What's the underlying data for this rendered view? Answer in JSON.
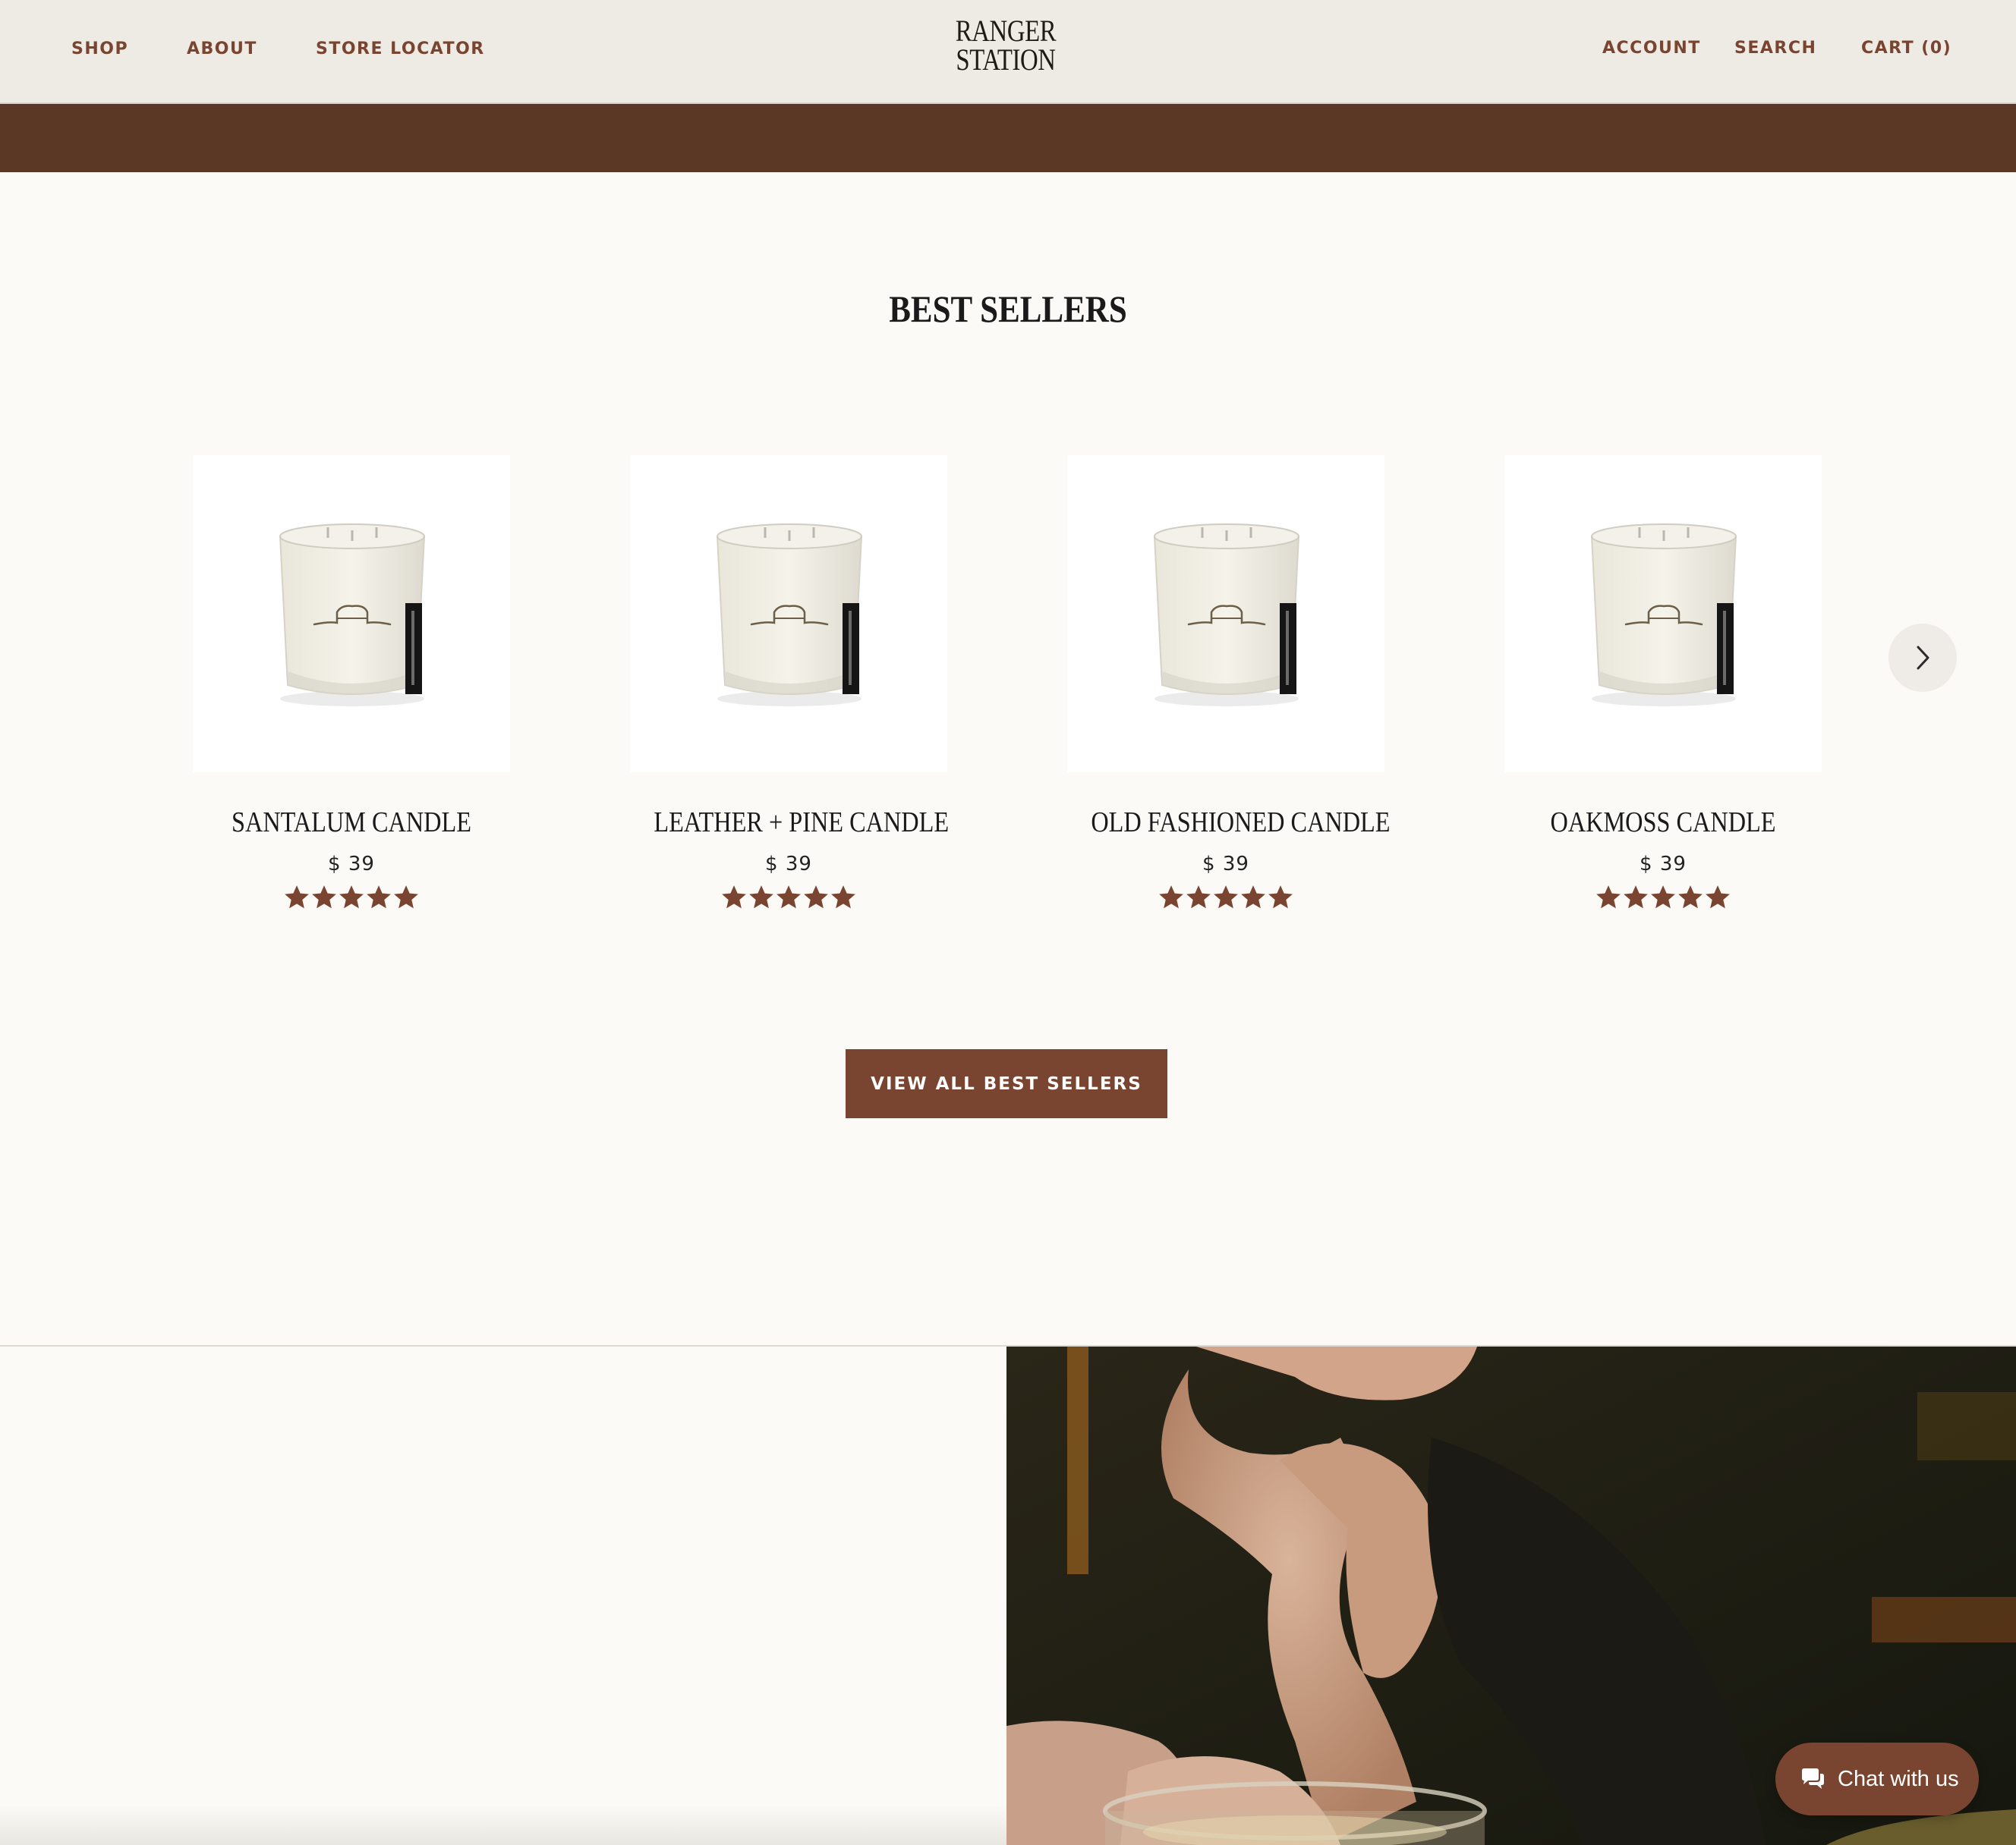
{
  "header": {
    "nav_left": [
      "SHOP",
      "ABOUT",
      "STORE LOCATOR"
    ],
    "logo_line1": "RANGER",
    "logo_line2": "STATION",
    "account": "ACCOUNT",
    "search": "SEARCH",
    "cart": "CART (0)"
  },
  "section": {
    "title": "BEST SELLERS",
    "cta": "VIEW ALL BEST SELLERS"
  },
  "products": [
    {
      "name": "SANTALUM CANDLE",
      "price": "$ 39",
      "rating": 5
    },
    {
      "name": "LEATHER + PINE CANDLE",
      "price": "$ 39",
      "rating": 5
    },
    {
      "name": "OLD FASHIONED CANDLE",
      "price": "$ 39",
      "rating": 5
    },
    {
      "name": "OAKMOSS CANDLE",
      "price": "$ 39",
      "rating": 5
    }
  ],
  "chat": {
    "label": "Chat with us"
  },
  "colors": {
    "accent": "#7a4530",
    "banner": "#5a3825",
    "header_bg": "#eeeae4",
    "page_bg": "#fbfaf6",
    "star": "#7a4530"
  },
  "icons": {
    "next": "chevron-right-icon",
    "chat": "chat-bubble-icon",
    "star": "star-icon"
  }
}
